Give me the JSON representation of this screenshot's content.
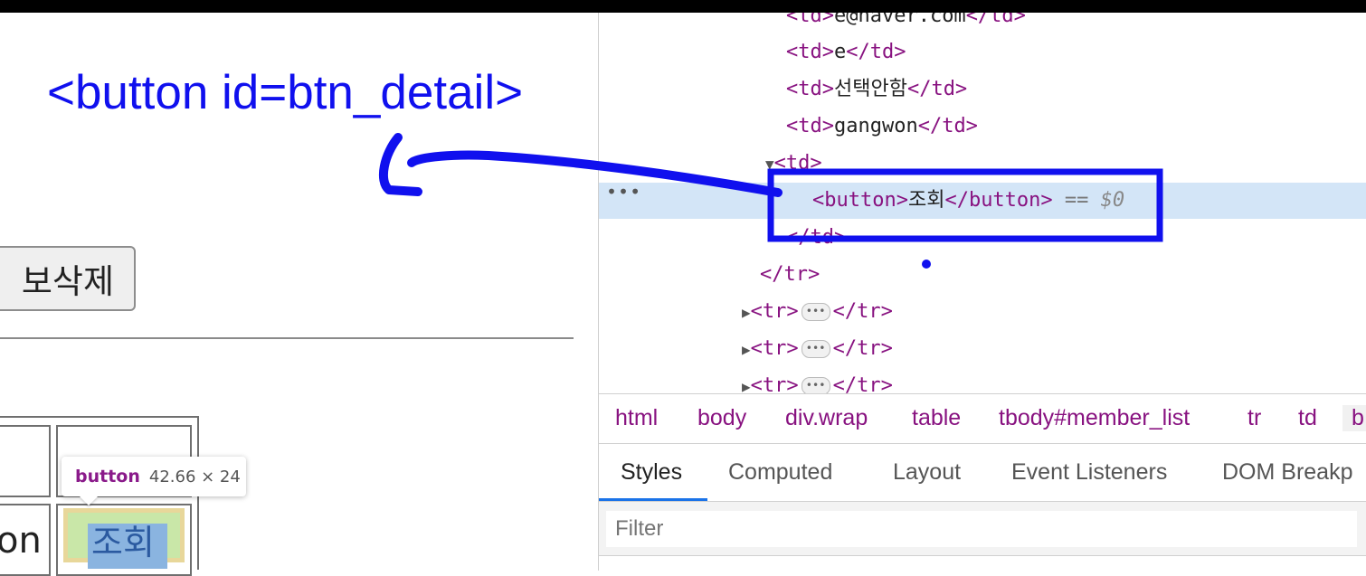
{
  "annotation": {
    "label": "<button id=btn_detail>",
    "color": "#1010ee"
  },
  "page": {
    "delete_button": "보삭제",
    "table": {
      "partial_cell_text": "on",
      "view_button": "조회"
    },
    "tooltip": {
      "tag": "button",
      "dimensions": "42.66 × 24"
    }
  },
  "devtools": {
    "dom_lines": [
      {
        "open": "<td>",
        "text": "e@naver.com",
        "close": "</td>"
      },
      {
        "open": "<td>",
        "text": "e",
        "close": "</td>"
      },
      {
        "open": "<td>",
        "text": "선택안함",
        "close": "</td>"
      },
      {
        "open": "<td>",
        "text": "gangwon",
        "close": "</td>"
      },
      {
        "open": "<td>",
        "text": "",
        "close": ""
      },
      {
        "open": "<button>",
        "text": "조회",
        "close": "</button>",
        "suffix": "==",
        "ref": "$0"
      },
      {
        "open": "</td>",
        "text": "",
        "close": ""
      },
      {
        "open": "</tr>",
        "text": "",
        "close": ""
      },
      {
        "open": "<tr>",
        "text": "",
        "close": "</tr>"
      },
      {
        "open": "<tr>",
        "text": "",
        "close": "</tr>"
      },
      {
        "open": "<tr>",
        "text": "",
        "close": "</tr>"
      }
    ],
    "breadcrumbs": [
      "html",
      "body",
      "div.wrap",
      "table",
      "tbody#member_list",
      "tr",
      "td",
      "b"
    ],
    "tabs": [
      "Styles",
      "Computed",
      "Layout",
      "Event Listeners",
      "DOM Breakp"
    ],
    "active_tab": "Styles",
    "filter_placeholder": "Filter",
    "accent_color": "#1a73e8",
    "tag_color": "#881280"
  }
}
